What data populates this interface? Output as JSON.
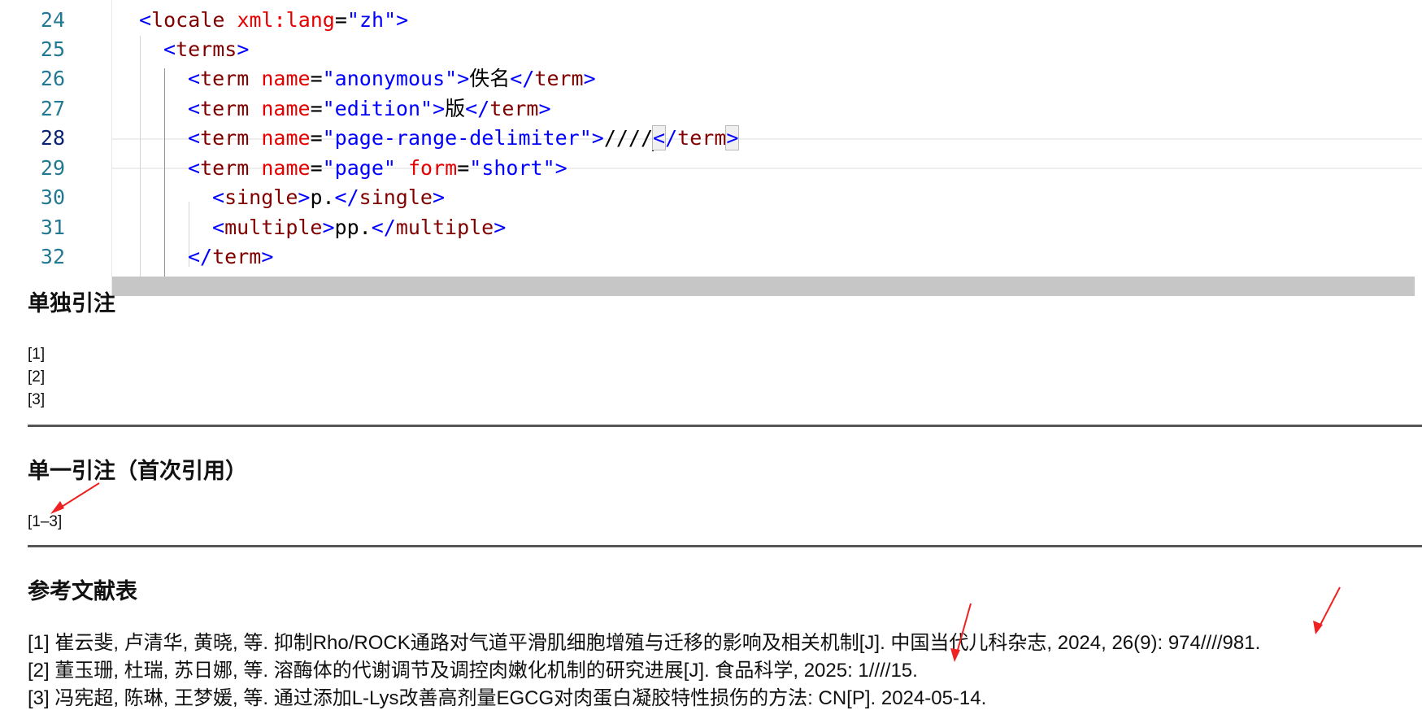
{
  "editor": {
    "lines": [
      {
        "num": "24",
        "tokens": [
          [
            "b",
            "<"
          ],
          [
            "t",
            "locale"
          ],
          [
            "s",
            " "
          ],
          [
            "a",
            "xml:lang"
          ],
          [
            "e",
            "="
          ],
          [
            "v",
            "\"zh\""
          ],
          [
            "b",
            ">"
          ]
        ]
      },
      {
        "num": "25",
        "tokens": [
          [
            "b",
            "<"
          ],
          [
            "t",
            "terms"
          ],
          [
            "b",
            ">"
          ]
        ]
      },
      {
        "num": "26",
        "tokens": [
          [
            "b",
            "<"
          ],
          [
            "t",
            "term"
          ],
          [
            "s",
            " "
          ],
          [
            "a",
            "name"
          ],
          [
            "e",
            "="
          ],
          [
            "v",
            "\"anonymous\""
          ],
          [
            "b",
            ">"
          ],
          [
            "x",
            "佚名"
          ],
          [
            "b",
            "</"
          ],
          [
            "t",
            "term"
          ],
          [
            "b",
            ">"
          ]
        ]
      },
      {
        "num": "27",
        "tokens": [
          [
            "b",
            "<"
          ],
          [
            "t",
            "term"
          ],
          [
            "s",
            " "
          ],
          [
            "a",
            "name"
          ],
          [
            "e",
            "="
          ],
          [
            "v",
            "\"edition\""
          ],
          [
            "b",
            ">"
          ],
          [
            "x",
            "版"
          ],
          [
            "b",
            "</"
          ],
          [
            "t",
            "term"
          ],
          [
            "b",
            ">"
          ]
        ]
      },
      {
        "num": "28",
        "tokens": [
          [
            "b",
            "<"
          ],
          [
            "t",
            "term"
          ],
          [
            "s",
            " "
          ],
          [
            "a",
            "name"
          ],
          [
            "e",
            "="
          ],
          [
            "v",
            "\"page-range-delimiter\""
          ],
          [
            "b",
            ">"
          ],
          [
            "x",
            "////"
          ],
          [
            "c",
            ""
          ],
          [
            "m",
            "<"
          ],
          [
            "b",
            "/"
          ],
          [
            "t",
            "term"
          ],
          [
            "m",
            ">"
          ]
        ]
      },
      {
        "num": "29",
        "tokens": [
          [
            "b",
            "<"
          ],
          [
            "t",
            "term"
          ],
          [
            "s",
            " "
          ],
          [
            "a",
            "name"
          ],
          [
            "e",
            "="
          ],
          [
            "v",
            "\"page\""
          ],
          [
            "s",
            " "
          ],
          [
            "a",
            "form"
          ],
          [
            "e",
            "="
          ],
          [
            "v",
            "\"short\""
          ],
          [
            "b",
            ">"
          ]
        ]
      },
      {
        "num": "30",
        "tokens": [
          [
            "b",
            "<"
          ],
          [
            "t",
            "single"
          ],
          [
            "b",
            ">"
          ],
          [
            "x",
            "p."
          ],
          [
            "b",
            "</"
          ],
          [
            "t",
            "single"
          ],
          [
            "b",
            ">"
          ]
        ]
      },
      {
        "num": "31",
        "tokens": [
          [
            "b",
            "<"
          ],
          [
            "t",
            "multiple"
          ],
          [
            "b",
            ">"
          ],
          [
            "x",
            "pp."
          ],
          [
            "b",
            "</"
          ],
          [
            "t",
            "multiple"
          ],
          [
            "b",
            ">"
          ]
        ]
      },
      {
        "num": "32",
        "tokens": [
          [
            "b",
            "</"
          ],
          [
            "t",
            "term"
          ],
          [
            "b",
            ">"
          ]
        ]
      }
    ],
    "current_line": "28"
  },
  "doc": {
    "section_individual": {
      "heading": "单独引注",
      "citations": [
        "[1]",
        "[2]",
        "[3]"
      ]
    },
    "section_single": {
      "heading": "单一引注（首次引用）",
      "citation": "[1–3]"
    },
    "section_bibliography": {
      "heading": "参考文献表",
      "entries": [
        "[1] 崔云斐, 卢清华, 黄晓, 等. 抑制Rho/ROCK通路对气道平滑肌细胞增殖与迁移的影响及相关机制[J]. 中国当代儿科杂志, 2024, 26(9): 974////981.",
        "[2] 董玉珊, 杜瑞, 苏日娜, 等. 溶酶体的代谢调节及调控肉嫩化机制的研究进展[J]. 食品科学, 2025: 1////15.",
        "[3] 冯宪超, 陈琳, 王梦媛, 等. 通过添加L-Lys改善高剂量EGCG对肉蛋白凝胶特性损伤的方法: CN[P]. 2024-05-14."
      ]
    }
  },
  "colors": {
    "annotation_arrow": "#ee2222",
    "line_number": "#237893",
    "xml_bracket": "#0000ff",
    "xml_tag": "#800000",
    "xml_attr": "#e50000"
  }
}
